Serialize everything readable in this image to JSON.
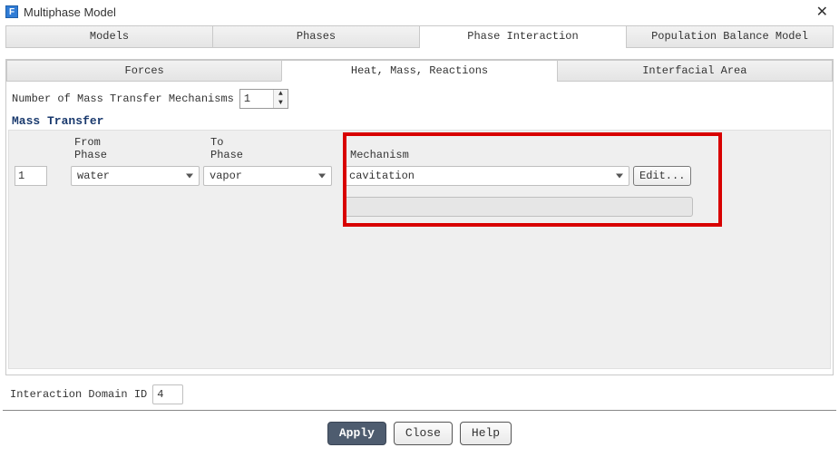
{
  "window": {
    "title": "Multiphase Model",
    "icon_text": "F"
  },
  "main_tabs": {
    "items": [
      {
        "label": "Models"
      },
      {
        "label": "Phases"
      },
      {
        "label": "Phase Interaction"
      },
      {
        "label": "Population Balance Model"
      }
    ],
    "active_index": 2
  },
  "sub_tabs": {
    "items": [
      {
        "label": "Forces"
      },
      {
        "label": "Heat, Mass, Reactions"
      },
      {
        "label": "Interfacial Area"
      }
    ],
    "active_index": 1
  },
  "num_mechanisms": {
    "label": "Number of Mass Transfer Mechanisms",
    "value": "1"
  },
  "section": {
    "title": "Mass Transfer",
    "headers": {
      "from_line1": "From",
      "from_line2": "Phase",
      "to_line1": "To",
      "to_line2": "Phase",
      "mechanism": "Mechanism"
    },
    "row": {
      "index": "1",
      "from_phase": "water",
      "to_phase": "vapor",
      "mechanism": "cavitation",
      "edit_label": "Edit..."
    }
  },
  "domain": {
    "label": "Interaction Domain ID",
    "value": "4"
  },
  "actions": {
    "apply": "Apply",
    "close": "Close",
    "help": "Help"
  }
}
